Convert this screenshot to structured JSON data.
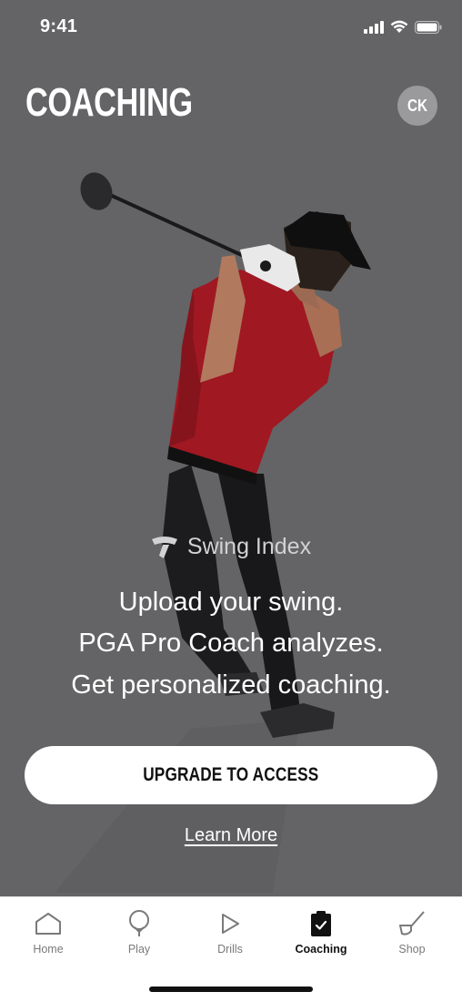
{
  "status_bar": {
    "time": "9:41"
  },
  "header": {
    "title": "COACHING",
    "avatar_initials": "CK"
  },
  "content": {
    "brand_name": "Swing Index",
    "tagline": [
      "Upload your swing.",
      "PGA Pro Coach analyzes.",
      "Get personalized coaching."
    ],
    "cta_label": "UPGRADE TO ACCESS",
    "learn_more_label": "Learn More"
  },
  "tabs": [
    {
      "label": "Home",
      "icon": "home-icon",
      "active": false
    },
    {
      "label": "Play",
      "icon": "pin-icon",
      "active": false
    },
    {
      "label": "Drills",
      "icon": "play-icon",
      "active": false
    },
    {
      "label": "Coaching",
      "icon": "clipboard-check-icon",
      "active": true
    },
    {
      "label": "Shop",
      "icon": "golf-club-icon",
      "active": false
    }
  ],
  "colors": {
    "background": "#646466",
    "shirt": "#a01822",
    "avatar": "#9a9a9d",
    "tab_active": "#111111",
    "tab_inactive": "#7a7a7a"
  }
}
